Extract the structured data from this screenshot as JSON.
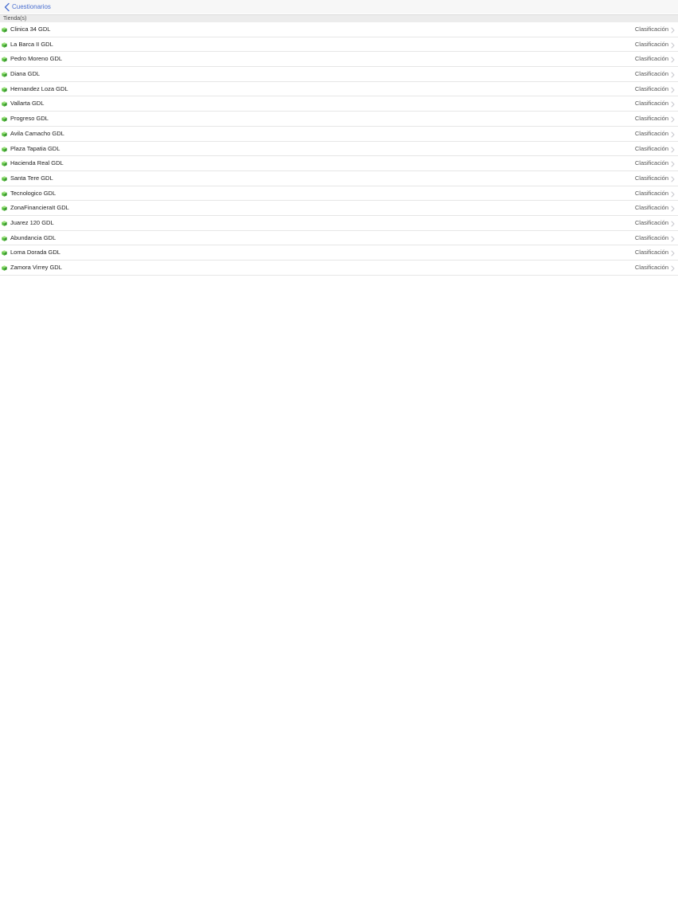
{
  "nav": {
    "back_label": "Cuestionarios",
    "back_icon": "chevron-left-icon"
  },
  "section": {
    "header": "Tienda(s)"
  },
  "stores": [
    {
      "name": "Clinica 34 GDL",
      "detail": "Clasificación"
    },
    {
      "name": "La Barca II GDL",
      "detail": "Clasificación"
    },
    {
      "name": "Pedro Moreno GDL",
      "detail": "Clasificación"
    },
    {
      "name": "Diana GDL",
      "detail": "Clasificación"
    },
    {
      "name": "Hernandez Loza GDL",
      "detail": "Clasificación"
    },
    {
      "name": "Vallarta GDL",
      "detail": "Clasificación"
    },
    {
      "name": "Progreso GDL",
      "detail": "Clasificación"
    },
    {
      "name": "Avila Camacho GDL",
      "detail": "Clasificación"
    },
    {
      "name": "Plaza Tapatia GDL",
      "detail": "Clasificación"
    },
    {
      "name": "Hacienda Real GDL",
      "detail": "Clasificación"
    },
    {
      "name": "Santa Tere GDL",
      "detail": "Clasificación"
    },
    {
      "name": "Tecnologico GDL",
      "detail": "Clasificación"
    },
    {
      "name": "ZonaFinancieraIt GDL",
      "detail": "Clasificación"
    },
    {
      "name": "Juarez 120 GDL",
      "detail": "Clasificación"
    },
    {
      "name": "Abundancia GDL",
      "detail": "Clasificación"
    },
    {
      "name": "Loma Dorada GDL",
      "detail": "Clasificación"
    },
    {
      "name": "Zamora Virrey GDL",
      "detail": "Clasificación"
    }
  ],
  "colors": {
    "accent": "#4a6fd0",
    "store_icon_light": "#7ed957",
    "store_icon_dark": "#3a9a2e",
    "chevron": "#c7c7cc"
  }
}
